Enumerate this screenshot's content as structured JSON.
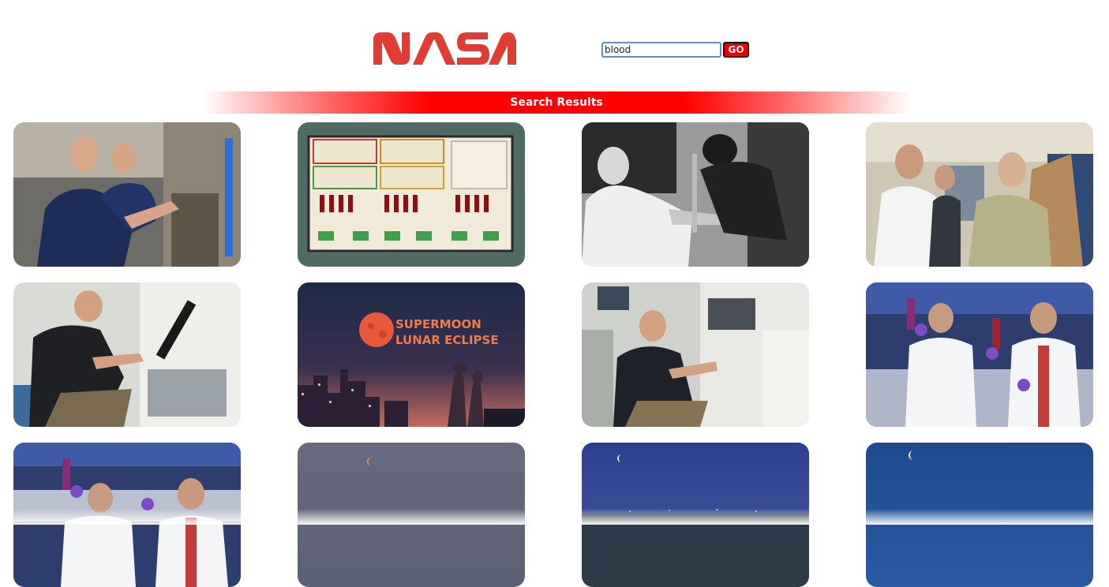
{
  "header": {
    "logo_icon": "nasa-worm-logo-icon",
    "brand_color": "#e03c31"
  },
  "search": {
    "value": "blood",
    "button_label": "GO"
  },
  "results": {
    "banner_title": "Search Results",
    "images": [
      {
        "id": "r1c1",
        "subject": "astronauts-station"
      },
      {
        "id": "r1c2",
        "subject": "blood-sample-kit"
      },
      {
        "id": "r1c3",
        "subject": "blood-draw-bw"
      },
      {
        "id": "r1c4",
        "subject": "medical-exam"
      },
      {
        "id": "r2c1",
        "subject": "astronaut-lab-rack"
      },
      {
        "id": "r2c2",
        "subject": "supermoon-poster",
        "caption_line1": "SUPERMOON",
        "caption_line2": "LUNAR ECLIPSE"
      },
      {
        "id": "r2c3",
        "subject": "astronaut-station-experiment"
      },
      {
        "id": "r2c4",
        "subject": "scientists-lab"
      },
      {
        "id": "r3c1",
        "subject": "scientists-lab-2"
      },
      {
        "id": "r3c2",
        "subject": "eclipse-sky-grey"
      },
      {
        "id": "r3c3",
        "subject": "eclipse-sky-city"
      },
      {
        "id": "r3c4",
        "subject": "eclipse-sky-blue"
      }
    ]
  }
}
